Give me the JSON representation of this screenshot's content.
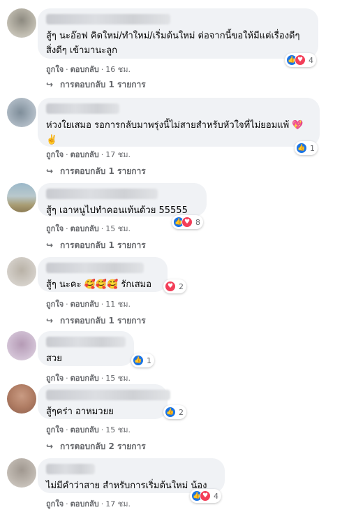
{
  "comments": [
    {
      "text": "สู้ๆ นะอ๊อฟ คิดใหม่/ทำใหม่/เริ่มต้นใหม่ ต่อจากนี้ขอให้มีแต่เรื่องดีๆ สิ่งดีๆ เข้ามานะลูก",
      "reaction_count": "4",
      "reactions": [
        "like-icon",
        "love-icon"
      ],
      "like": "ถูกใจ",
      "reply": "ตอบกลับ",
      "time": "16 ชม.",
      "replies": "การตอบกลับ 1 รายการ"
    },
    {
      "text": "ห่วงใยเสมอ รอการกลับมาพรุ่งนี้ไม่สายสำหรับหัวใจที่ไม่ยอมแพ้ 💖✌️",
      "reaction_count": "1",
      "reactions": [
        "like-icon"
      ],
      "like": "ถูกใจ",
      "reply": "ตอบกลับ",
      "time": "17 ชม.",
      "replies": "การตอบกลับ 1 รายการ"
    },
    {
      "text": "สู้ๆ เอาหนูไปทำคอนเท้นด้วย 55555",
      "reaction_count": "8",
      "reactions": [
        "like-icon",
        "love-icon"
      ],
      "like": "ถูกใจ",
      "reply": "ตอบกลับ",
      "time": "15 ชม.",
      "replies": "การตอบกลับ 1 รายการ"
    },
    {
      "text": "สู้ๆ นะคะ 🥰🥰🥰 รักเสมอ",
      "reaction_count": "2",
      "reactions": [
        "love-icon"
      ],
      "like": "ถูกใจ",
      "reply": "ตอบกลับ",
      "time": "11 ชม.",
      "replies": "การตอบกลับ 1 รายการ"
    },
    {
      "text": "สวย",
      "reaction_count": "1",
      "reactions": [
        "like-icon"
      ],
      "like": "ถูกใจ",
      "reply": "ตอบกลับ",
      "time": "15 ชม.",
      "replies": ""
    },
    {
      "text": "สู้ๆคร่า อาหมวยย",
      "reaction_count": "2",
      "reactions": [
        "like-icon"
      ],
      "like": "ถูกใจ",
      "reply": "ตอบกลับ",
      "time": "15 ชม.",
      "replies": "การตอบกลับ 2 รายการ"
    },
    {
      "text": "ไม่มีคำว่าสาย สำหรับการเริ่มต้นใหม่ น้อง",
      "reaction_count": "4",
      "reactions": [
        "like-icon",
        "love-icon"
      ],
      "like": "ถูกใจ",
      "reply": "ตอบกลับ",
      "time": "17 ชม.",
      "replies": ""
    }
  ],
  "colors": {
    "bubble": "#f0f2f5",
    "like": "#1b74e4",
    "love": "#f33e58",
    "meta": "#65676b"
  }
}
